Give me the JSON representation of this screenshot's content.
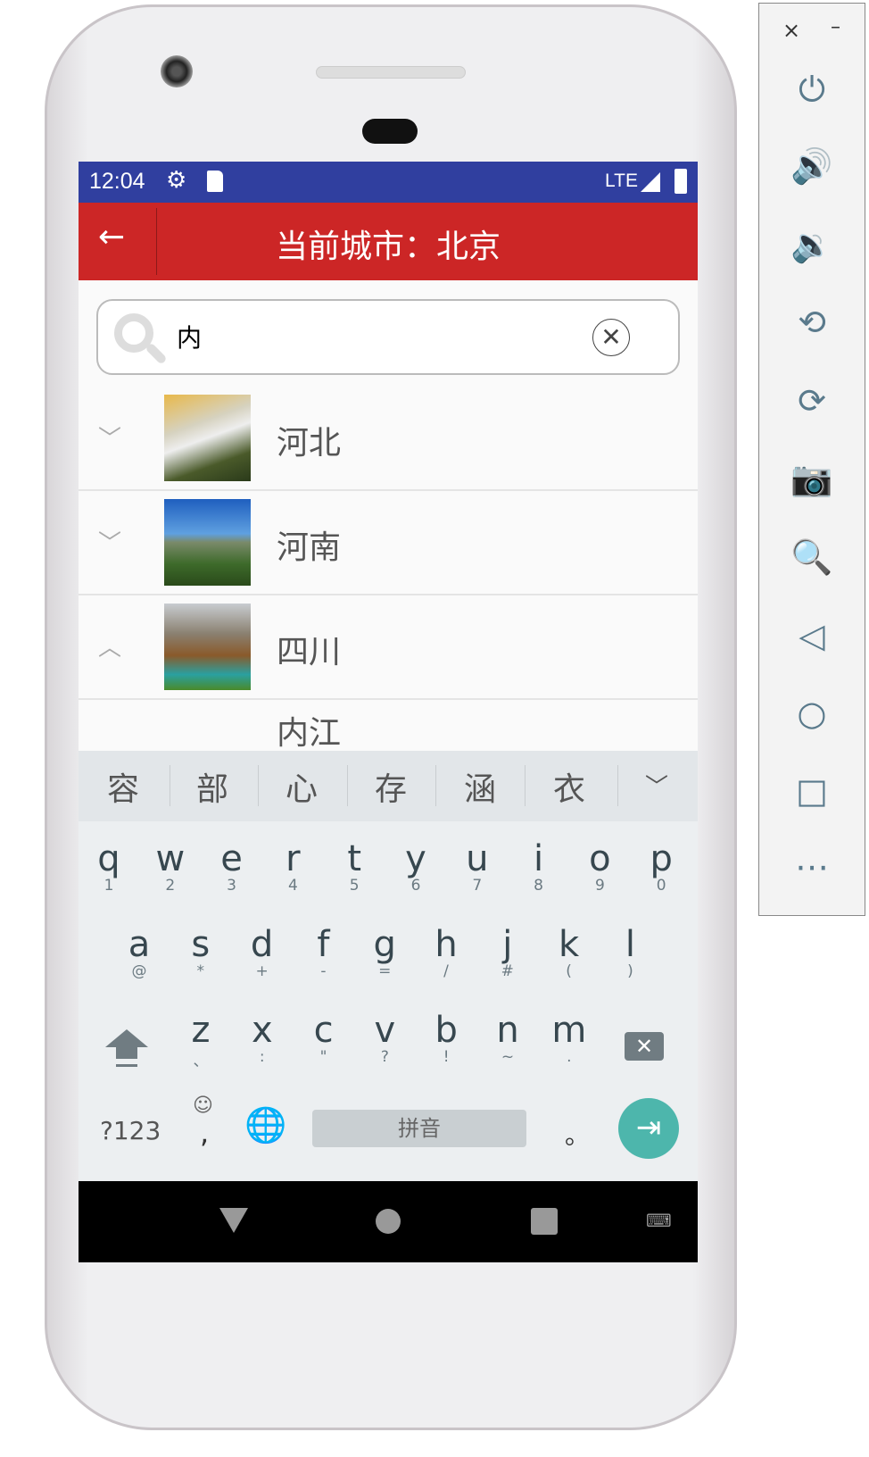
{
  "status_bar": {
    "time": "12:04",
    "network": "LTE",
    "icons": [
      "gear-icon",
      "sd-card-icon",
      "signal-icon",
      "battery-charging-icon"
    ],
    "color": "#303f9f"
  },
  "toolbar": {
    "back_icon": "arrow-left-icon",
    "title": "当前城市：北京",
    "color": "#cc2626"
  },
  "search": {
    "value": "内",
    "clear_icon": "clear-circle-icon",
    "search_icon": "magnifier-icon"
  },
  "list": {
    "items": [
      {
        "name": "河北",
        "expanded": false
      },
      {
        "name": "河南",
        "expanded": false
      },
      {
        "name": "四川",
        "expanded": true,
        "children": [
          "内江"
        ]
      }
    ]
  },
  "ime": {
    "candidates": [
      "容",
      "部",
      "心",
      "存",
      "涵",
      "衣"
    ],
    "row1": [
      [
        "q",
        "1"
      ],
      [
        "w",
        "2"
      ],
      [
        "e",
        "3"
      ],
      [
        "r",
        "4"
      ],
      [
        "t",
        "5"
      ],
      [
        "y",
        "6"
      ],
      [
        "u",
        "7"
      ],
      [
        "i",
        "8"
      ],
      [
        "o",
        "9"
      ],
      [
        "p",
        "0"
      ]
    ],
    "row2": [
      [
        "a",
        "@"
      ],
      [
        "s",
        "*"
      ],
      [
        "d",
        "+"
      ],
      [
        "f",
        "-"
      ],
      [
        "g",
        "="
      ],
      [
        "h",
        "/"
      ],
      [
        "j",
        "#"
      ],
      [
        "k",
        "("
      ],
      [
        "l",
        ")"
      ]
    ],
    "row3": [
      [
        "z",
        "、"
      ],
      [
        "x",
        ":"
      ],
      [
        "c",
        "\""
      ],
      [
        "v",
        "?"
      ],
      [
        "b",
        "!"
      ],
      [
        "n",
        "~"
      ],
      [
        "m",
        "."
      ]
    ],
    "symbols_key": "?123",
    "comma_key": ",",
    "space_label": "拼音",
    "period_key": "。",
    "enter_color": "#4db6ac"
  },
  "emulator_panel": {
    "close": "×",
    "minimize": "–",
    "buttons": [
      "power-icon",
      "volume-up-icon",
      "volume-down-icon",
      "rotate-left-icon",
      "rotate-right-icon",
      "camera-icon",
      "zoom-icon",
      "back-icon",
      "home-icon",
      "overview-icon",
      "more-icon"
    ]
  }
}
